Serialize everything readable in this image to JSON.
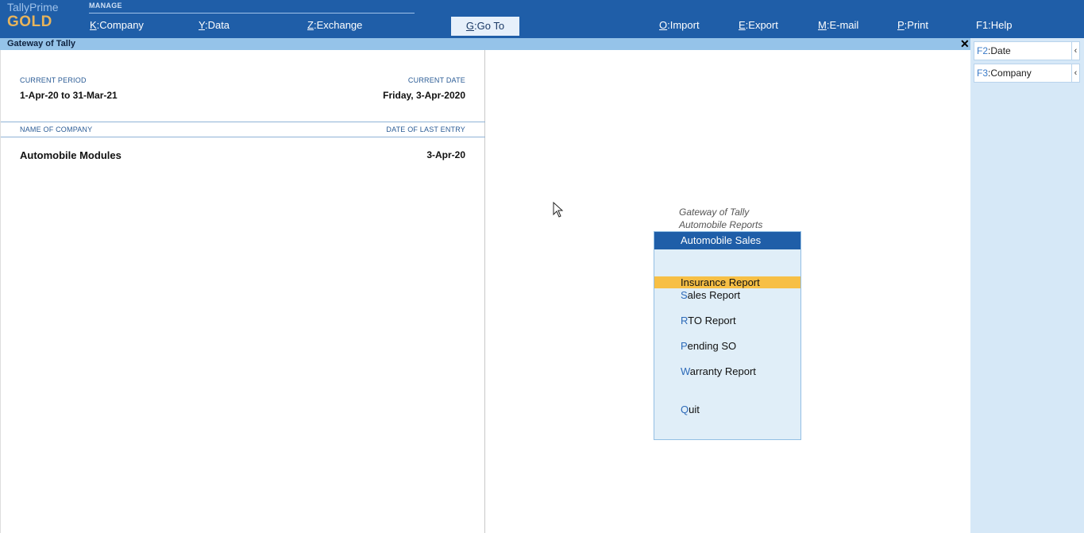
{
  "brand": {
    "product": "TallyPrime",
    "edition": "GOLD"
  },
  "topbar": {
    "section_label": "MANAGE",
    "company": {
      "key": "K",
      "label": ":Company"
    },
    "data": {
      "key": "Y",
      "label": ":Data"
    },
    "exchange": {
      "key": "Z",
      "label": ":Exchange"
    },
    "goto": {
      "key": "G",
      "label": ":Go To"
    },
    "import": {
      "key": "O",
      "label": ":Import"
    },
    "export": {
      "key": "E",
      "label": ":Export"
    },
    "email": {
      "key": "M",
      "label": ":E-mail"
    },
    "print": {
      "key": "P",
      "label": ":Print"
    },
    "help": {
      "key": "F1",
      "label": ":Help"
    }
  },
  "titlebar": {
    "title": "Gateway of Tally",
    "close_glyph": "✕"
  },
  "info": {
    "current_period_label": "CURRENT PERIOD",
    "current_period_value": "1-Apr-20 to 31-Mar-21",
    "current_date_label": "CURRENT DATE",
    "current_date_value": "Friday, 3-Apr-2020",
    "company_col_label": "NAME OF COMPANY",
    "last_entry_col_label": "DATE OF LAST ENTRY",
    "company_name": "Automobile Modules",
    "last_entry_date": "3-Apr-20"
  },
  "right_panel": {
    "date_btn": {
      "key": "F2",
      "label": ":Date"
    },
    "company_btn": {
      "key": "F3",
      "label": ":Company"
    },
    "chevron_glyph": "‹"
  },
  "menu": {
    "caption_line1": "Gateway of Tally",
    "caption_line2": "Automobile Reports",
    "header": "Automobile Sales",
    "items": [
      {
        "hotkey": "I",
        "rest": "nsurance Report",
        "selected": true
      },
      {
        "hotkey": "S",
        "rest": "ales Report",
        "selected": false
      },
      {
        "hotkey": "R",
        "rest": "TO Report",
        "selected": false
      },
      {
        "hotkey": "P",
        "rest": "ending SO",
        "selected": false
      },
      {
        "hotkey": "W",
        "rest": "arranty Report",
        "selected": false
      },
      {
        "hotkey": "Q",
        "rest": "uit",
        "selected": false
      }
    ]
  },
  "colors": {
    "topbar_bg": "#1f5ea8",
    "title_strip": "#95c3e9",
    "selected_item": "#f7bf45",
    "menu_bg": "#e0eef8"
  },
  "icons": {
    "close": "close-icon",
    "pointer": "mouse-pointer-icon",
    "chevron": "chevron-left-icon"
  }
}
